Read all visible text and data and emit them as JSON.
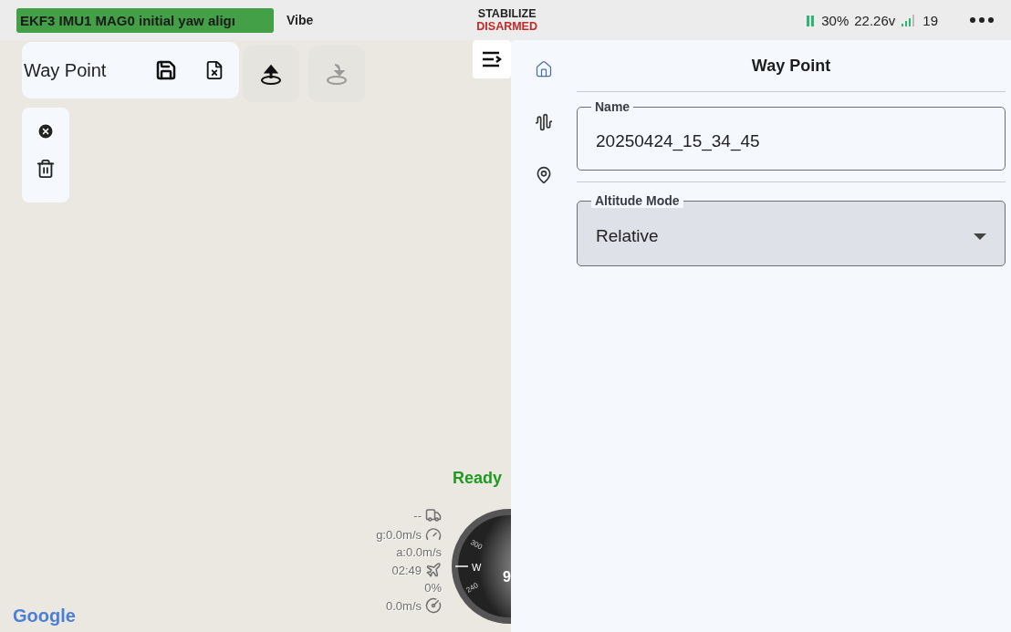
{
  "status_bar": {
    "message": "EKF3 IMU1 MAG0 initial yaw aligı",
    "vibe": "Vibe",
    "mode": "STABILIZE",
    "arm_state": "DISARMED",
    "armed": false,
    "battery_percent": "30%",
    "voltage": "22.26v",
    "satellites": "19"
  },
  "map_toolbar": {
    "title": "Way Point",
    "upload_disabled": false,
    "download_disabled": true
  },
  "map": {
    "ready": "Ready",
    "attribution": "Google",
    "hud": [
      {
        "kind": "distance",
        "text": "--"
      },
      {
        "kind": "speed",
        "text": "g:0.0m/s"
      },
      {
        "kind": "speed2",
        "text": "a:0.0m/s"
      },
      {
        "kind": "time",
        "text": "02:49"
      },
      {
        "kind": "throttle",
        "text": "0%"
      },
      {
        "kind": "climb",
        "text": "0.0m/s"
      }
    ],
    "compass_labels": [
      "300",
      "W",
      "240",
      "9"
    ]
  },
  "sidebar": {
    "items": [
      {
        "kind": "home",
        "selected": true
      },
      {
        "kind": "wave",
        "selected": false
      },
      {
        "kind": "pin",
        "selected": false
      }
    ]
  },
  "panel": {
    "title": "Way Point",
    "name_field": {
      "label": "Name",
      "value": "20250424_15_34_45"
    },
    "altitude_mode": {
      "label": "Altitude Mode",
      "value": "Relative"
    }
  }
}
